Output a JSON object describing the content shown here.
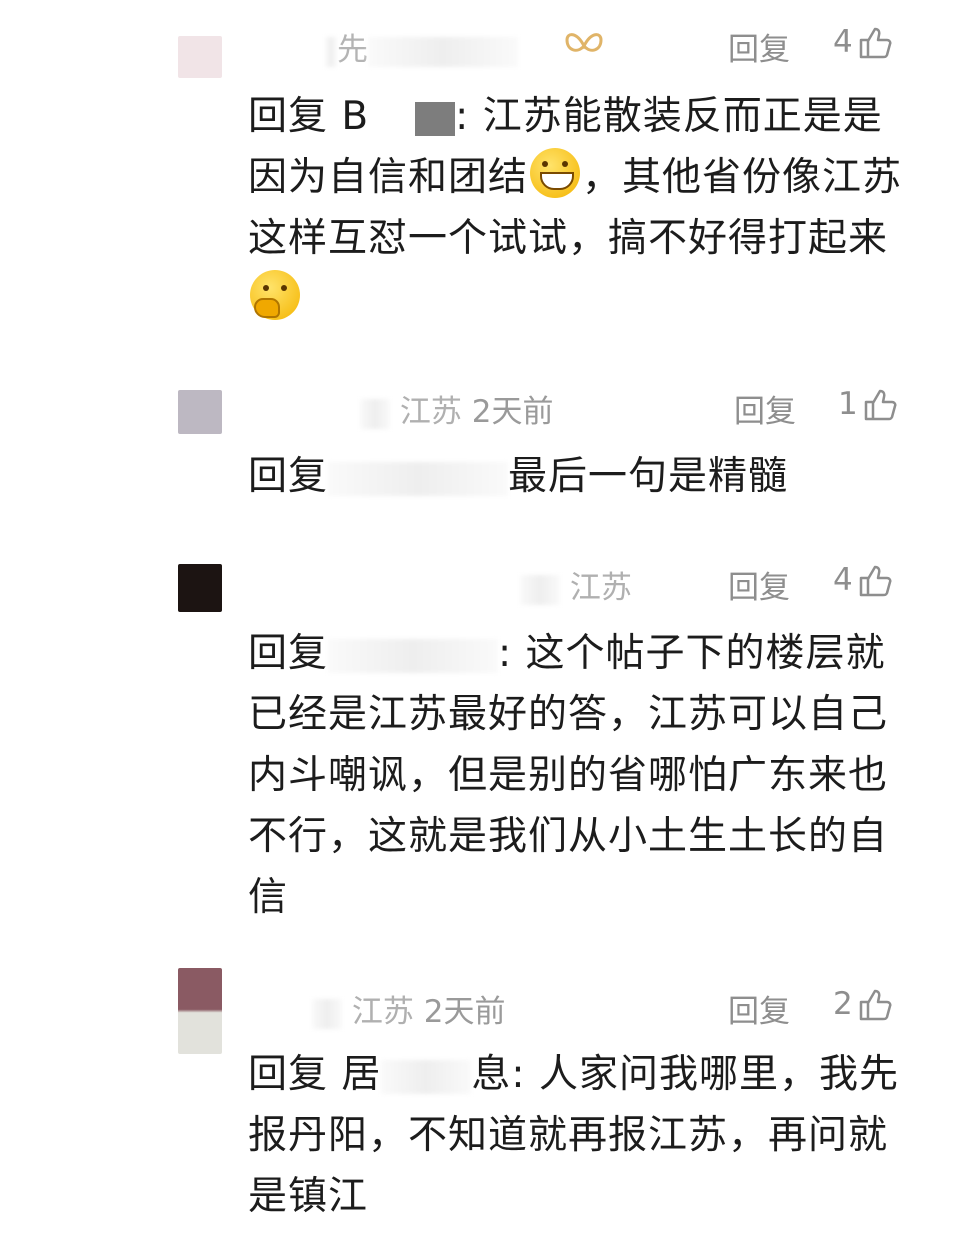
{
  "comments": [
    {
      "name_visible": "先",
      "location": "",
      "time": "",
      "reply_label": "回复",
      "likes": "4",
      "text_prefix": "回复 B",
      "text_after_mask": ": 江苏能散装反而正是是因为自信和团结",
      "text_after_emoji1": "，其他省份像江苏这样互怼一个试试，搞不好得打起来",
      "emoji1": "grinning-face",
      "emoji2": "thinking-face",
      "avatar_color": "#f0e3e6"
    },
    {
      "name_visible": "",
      "location": "江苏",
      "time": "2天前",
      "reply_label": "回复",
      "likes": "1",
      "text_prefix": "回复",
      "text_after_mask": "最后一句是精髓",
      "avatar_color": "#bdb8c2"
    },
    {
      "name_visible": "",
      "location": "江苏",
      "time": "",
      "reply_label": "回复",
      "likes": "4",
      "text_prefix": "回复",
      "text_after_mask": ": 这个帖子下的楼层就已经是江苏最好的答，江苏可以自己内斗嘲讽，但是别的省哪怕广东来也不行，这就是我们从小土生土长的自信",
      "avatar_color": "#1c1412"
    },
    {
      "name_visible": "",
      "location": "江苏",
      "time": "2天前",
      "reply_label": "回复",
      "likes": "2",
      "text_prefix": "回复 居",
      "text_after_mask": "息: 人家问我哪里，我先报丹阳，不知道就再报江苏，再问就是镇江",
      "avatar_color": "#8a5a63"
    }
  ]
}
